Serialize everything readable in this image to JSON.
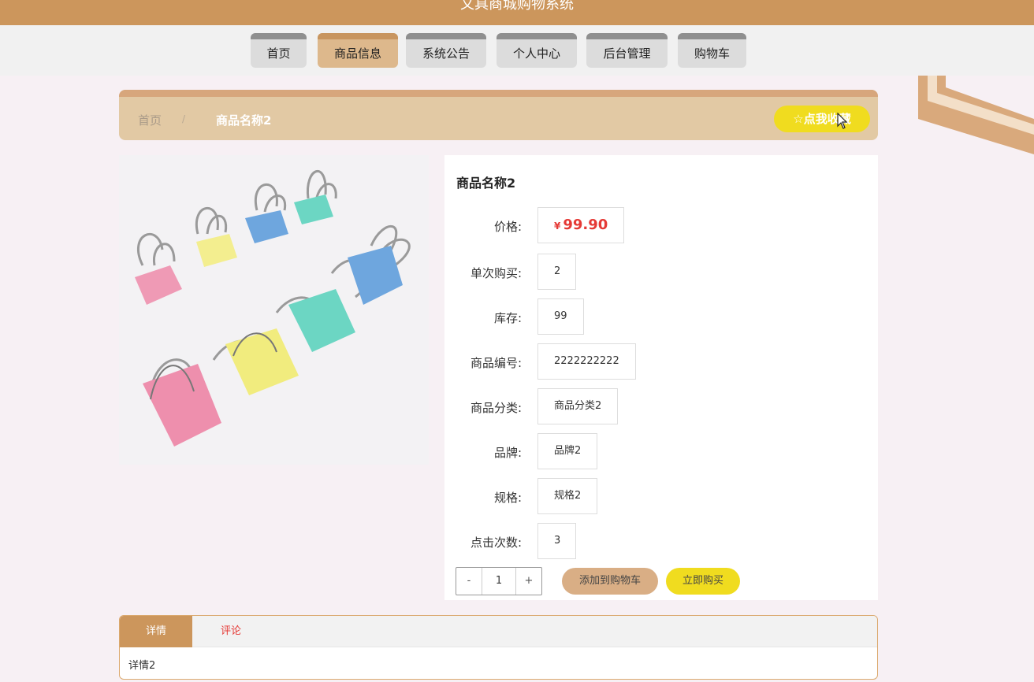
{
  "app": {
    "title": "文具商城购物系统"
  },
  "nav": {
    "items": [
      {
        "label": "首页"
      },
      {
        "label": "商品信息"
      },
      {
        "label": "系统公告"
      },
      {
        "label": "个人中心"
      },
      {
        "label": "后台管理"
      },
      {
        "label": "购物车"
      }
    ],
    "active_index": 1
  },
  "breadcrumb": {
    "home": "首页",
    "separator": "/",
    "current": "商品名称2"
  },
  "favorite_button": {
    "icon": "star-outline-icon",
    "label": "点我收藏"
  },
  "product": {
    "name": "商品名称2",
    "image_desc_icon": "binder-clips-photo",
    "fields": [
      {
        "label": "价格:",
        "value": "99.90",
        "currency": "¥"
      },
      {
        "label": "单次购买:",
        "value": "2"
      },
      {
        "label": "库存:",
        "value": "99"
      },
      {
        "label": "商品编号:",
        "value": "2222222222"
      },
      {
        "label": "商品分类:",
        "value": "商品分类2"
      },
      {
        "label": "品牌:",
        "value": "品牌2"
      },
      {
        "label": "规格:",
        "value": "规格2"
      },
      {
        "label": "点击次数:",
        "value": "3"
      }
    ]
  },
  "quantity": {
    "minus": "-",
    "value": "1",
    "plus": "+"
  },
  "actions": {
    "add_to_cart": "添加到购物车",
    "buy_now": "立即购买"
  },
  "tabs": {
    "items": [
      {
        "label": "详情"
      },
      {
        "label": "评论"
      }
    ],
    "active_index": 0,
    "content": "详情2"
  },
  "colors": {
    "header": "#cc965c",
    "nav_active": "#ddb88c",
    "breadcrumb_bg": "#e2c9a4",
    "accent_yellow": "#f0dc1f",
    "price_red": "#e53935"
  }
}
